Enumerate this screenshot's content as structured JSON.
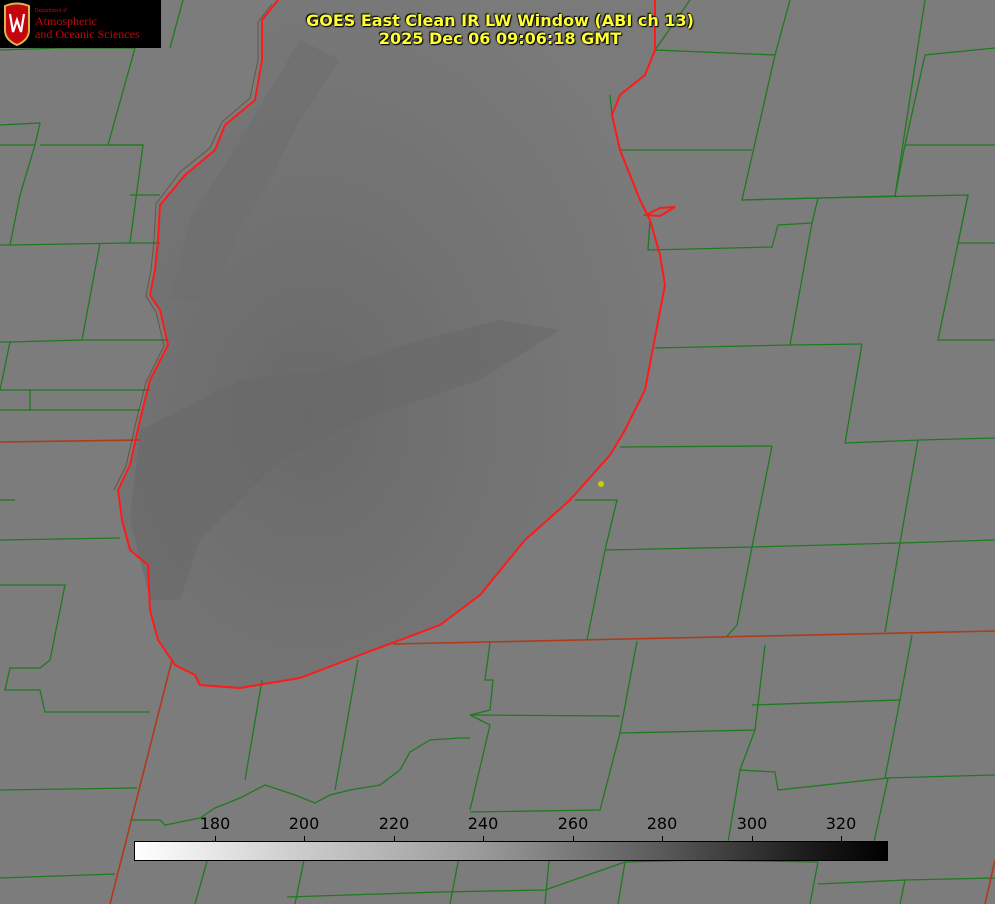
{
  "logo": {
    "department": "Department of",
    "line1": "Atmospheric",
    "line2": "and Oceanic Sciences"
  },
  "title": {
    "line1": "GOES East Clean IR LW Window (ABI ch 13)",
    "line2": "2025 Dec 06 09:06:18 GMT"
  },
  "colorbar": {
    "ticks": [
      "180",
      "200",
      "220",
      "240",
      "260",
      "280",
      "300",
      "320"
    ]
  },
  "colors": {
    "county_lines": "#1f7a1f",
    "state_lines": "#b03a1a",
    "lake_outline": "#ff1a1a",
    "title_text": "#ffff33",
    "marker": "#cccc00"
  }
}
